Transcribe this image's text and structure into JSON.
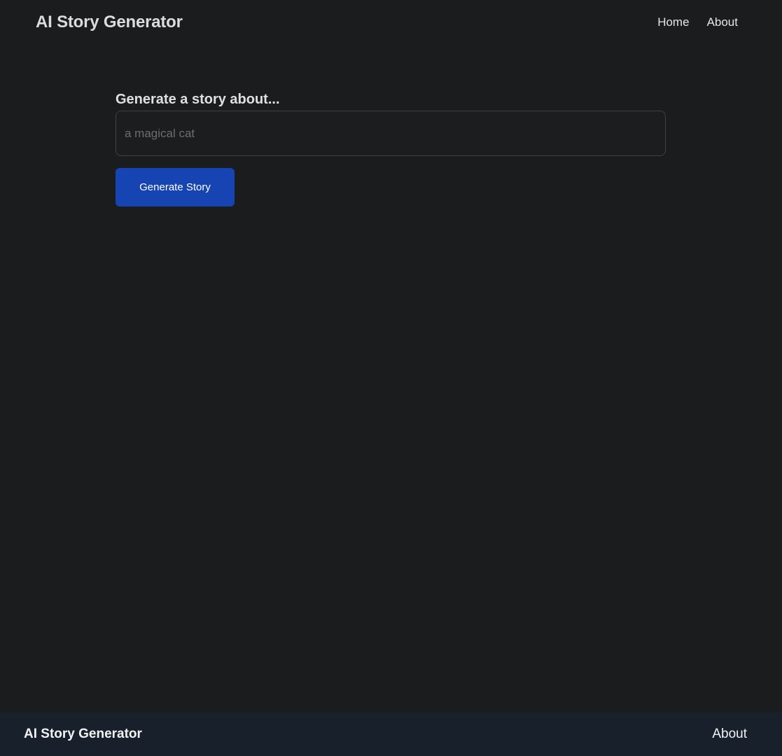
{
  "header": {
    "title": "AI Story Generator",
    "nav": [
      {
        "label": "Home"
      },
      {
        "label": "About"
      }
    ]
  },
  "form": {
    "label": "Generate a story about...",
    "input_value": "",
    "input_placeholder": "a magical cat",
    "submit_label": "Generate Story"
  },
  "footer": {
    "title": "AI Story Generator",
    "link_label": "About"
  },
  "colors": {
    "background": "#1b1c1e",
    "accent": "#1744b3",
    "footer_bg": "#18202c"
  }
}
